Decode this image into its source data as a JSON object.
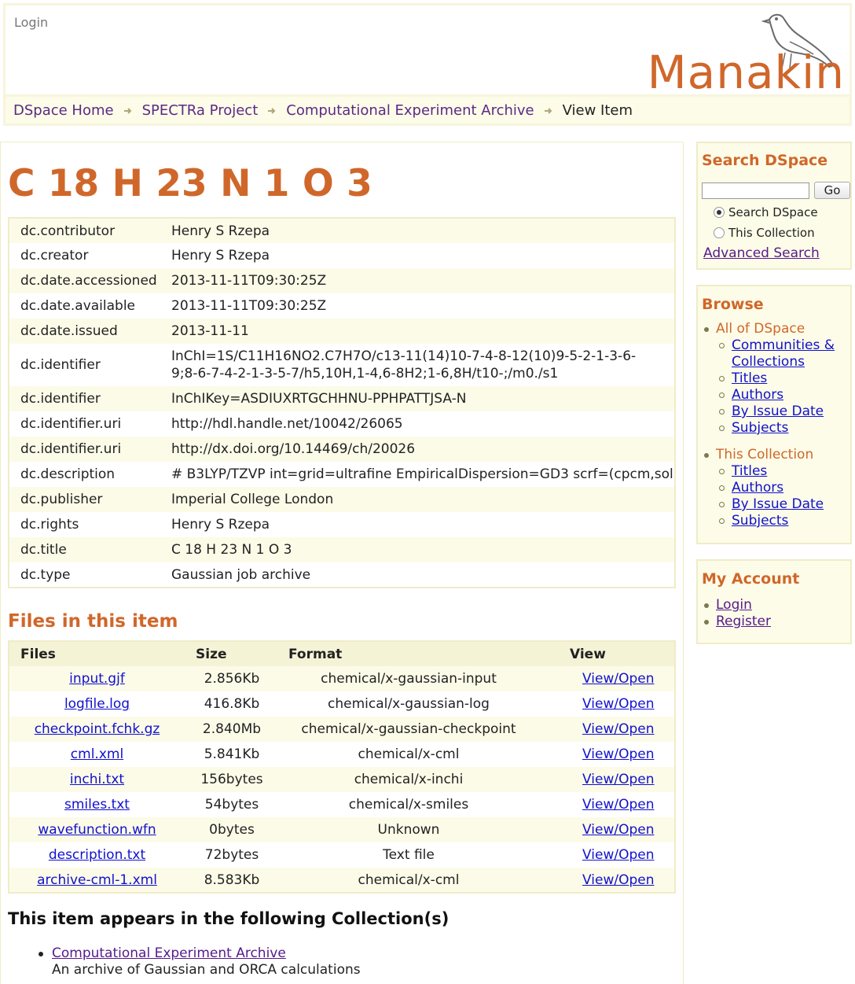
{
  "header": {
    "login_label": "Login",
    "logo_text": "Manakin"
  },
  "breadcrumb": {
    "items": [
      "DSpace Home",
      "SPECTRa Project",
      "Computational Experiment Archive"
    ],
    "current": "View Item"
  },
  "item": {
    "title": "C 18 H 23 N 1 O 3",
    "metadata": [
      {
        "key": "dc.contributor",
        "value": "Henry S Rzepa"
      },
      {
        "key": "dc.creator",
        "value": "Henry S Rzepa"
      },
      {
        "key": "dc.date.accessioned",
        "value": "2013-11-11T09:30:25Z"
      },
      {
        "key": "dc.date.available",
        "value": "2013-11-11T09:30:25Z"
      },
      {
        "key": "dc.date.issued",
        "value": "2013-11-11"
      },
      {
        "key": "dc.identifier",
        "value": "InChI=1S/C11H16NO2.C7H7O/c13-11(14)10-7-4-8-12(10)9-5-2-1-3-6-9;8-6-7-4-2-1-3-5-7/h5,10H,1-4,6-8H2;1-6,8H/t10-;/m0./s1"
      },
      {
        "key": "dc.identifier",
        "value": "InChIKey=ASDIUXRTGCHHNU-PPHPATTJSA-N"
      },
      {
        "key": "dc.identifier.uri",
        "value": "http://hdl.handle.net/10042/26065"
      },
      {
        "key": "dc.identifier.uri",
        "value": "http://dx.doi.org/10.14469/ch/20026"
      },
      {
        "key": "dc.description",
        "value": "# B3LYP/TZVP int=grid=ultrafine EmpiricalDispersion=GD3 scrf=(cpcm,sol"
      },
      {
        "key": "dc.publisher",
        "value": "Imperial College London"
      },
      {
        "key": "dc.rights",
        "value": "Henry S Rzepa"
      },
      {
        "key": "dc.title",
        "value": "C 18 H 23 N 1 O 3"
      },
      {
        "key": "dc.type",
        "value": "Gaussian job archive"
      }
    ]
  },
  "files": {
    "heading": "Files in this item",
    "columns": [
      "Files",
      "Size",
      "Format",
      "View"
    ],
    "rows": [
      {
        "name": "input.gjf",
        "size": "2.856Kb",
        "format": "chemical/x-gaussian-input",
        "view": "View/Open"
      },
      {
        "name": "logfile.log",
        "size": "416.8Kb",
        "format": "chemical/x-gaussian-log",
        "view": "View/Open"
      },
      {
        "name": "checkpoint.fchk.gz",
        "size": "2.840Mb",
        "format": "chemical/x-gaussian-checkpoint",
        "view": "View/Open"
      },
      {
        "name": "cml.xml",
        "size": "5.841Kb",
        "format": "chemical/x-cml",
        "view": "View/Open"
      },
      {
        "name": "inchi.txt",
        "size": "156bytes",
        "format": "chemical/x-inchi",
        "view": "View/Open"
      },
      {
        "name": "smiles.txt",
        "size": "54bytes",
        "format": "chemical/x-smiles",
        "view": "View/Open"
      },
      {
        "name": "wavefunction.wfn",
        "size": "0bytes",
        "format": "Unknown",
        "view": "View/Open"
      },
      {
        "name": "description.txt",
        "size": "72bytes",
        "format": "Text file",
        "view": "View/Open"
      },
      {
        "name": "archive-cml-1.xml",
        "size": "8.583Kb",
        "format": "chemical/x-cml",
        "view": "View/Open"
      }
    ]
  },
  "collections": {
    "heading": "This item appears in the following Collection(s)",
    "items": [
      {
        "name": "Computational Experiment Archive",
        "description": "An archive of Gaussian and ORCA calculations"
      }
    ]
  },
  "sidebar": {
    "search": {
      "heading": "Search DSpace",
      "input_value": "",
      "go_label": "Go",
      "scope_options": [
        "Search DSpace",
        "This Collection"
      ],
      "selected_scope": "Search DSpace",
      "advanced_label": "Advanced Search"
    },
    "browse": {
      "heading": "Browse",
      "groups": [
        {
          "label": "All of DSpace",
          "links": [
            "Communities & Collections",
            "Titles",
            "Authors",
            "By Issue Date",
            "Subjects"
          ]
        },
        {
          "label": "This Collection",
          "links": [
            "Titles",
            "Authors",
            "By Issue Date",
            "Subjects"
          ]
        }
      ]
    },
    "account": {
      "heading": "My Account",
      "links": [
        "Login",
        "Register"
      ]
    }
  },
  "colors": {
    "accent": "#d0672a",
    "panel_bg": "#fcfce8",
    "border": "#f0ecc8",
    "link": "#1111cc",
    "visited": "#551a8b"
  }
}
